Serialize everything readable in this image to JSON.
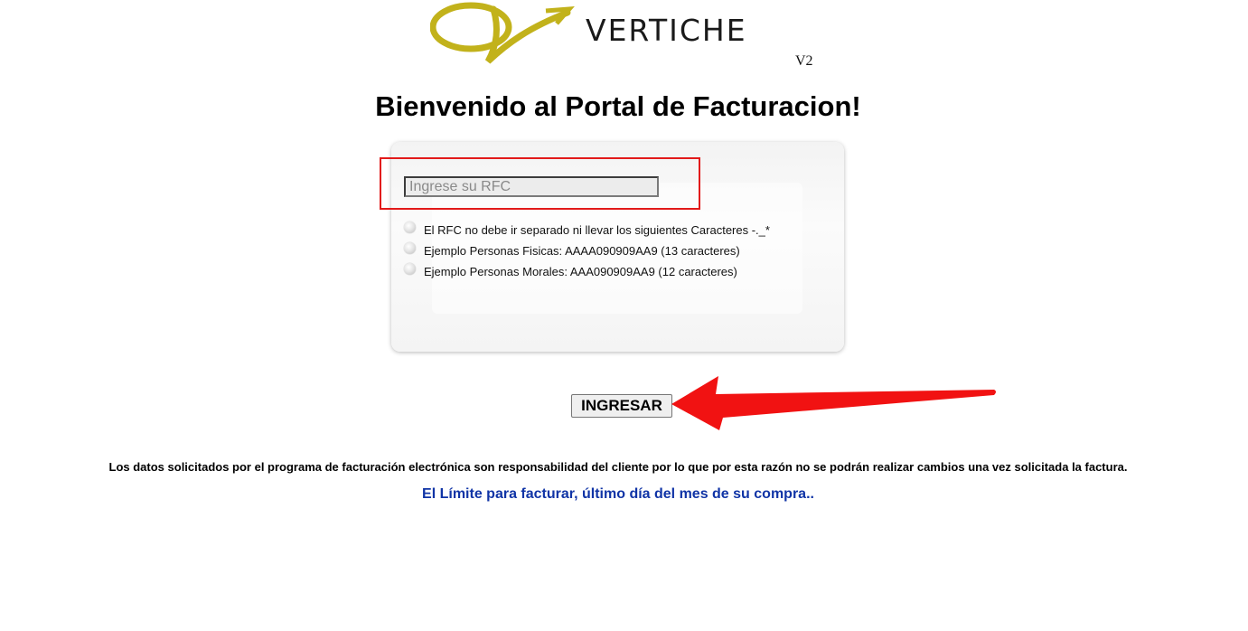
{
  "header": {
    "brand_name": "VERTICHE",
    "version": "V2"
  },
  "title": "Bienvenido al Portal de Facturacion!",
  "form": {
    "rfc_placeholder": "Ingrese su RFC",
    "rfc_value": "",
    "notes": [
      "El RFC no debe ir separado ni llevar los siguientes Caracteres -._*",
      "Ejemplo Personas Fisicas: AAAA090909AA9 (13 caracteres)",
      "Ejemplo Personas Morales: AAA090909AA9 (12 caracteres)"
    ],
    "submit_label": "INGRESAR"
  },
  "footer": {
    "disclaimer": "Los datos solicitados por el programa de facturación electrónica son responsabilidad del cliente por lo que por esta razón no se podrán realizar cambios una vez solicitada la factura.",
    "limit_notice": "El Límite para facturar, último día del mes de su compra.."
  },
  "colors": {
    "logo_gold": "#c2b21b",
    "annotation_red": "#e21a1a",
    "notice_blue": "#1034a6"
  },
  "icons": {
    "logo": "verticheV-logo",
    "bullet": "radio-bullet-icon",
    "annotation_arrow": "red-arrow-annotation"
  }
}
